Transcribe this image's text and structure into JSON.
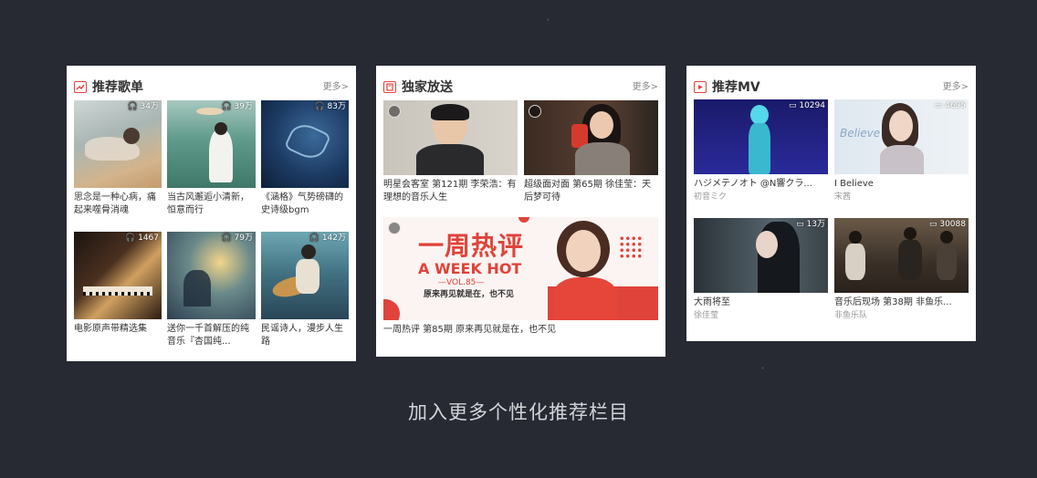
{
  "playlists": {
    "title": "推荐歌单",
    "more": "更多>",
    "items": [
      {
        "count": "34万",
        "caption": "思念是一种心病，痛起来噬骨消魂"
      },
      {
        "count": "39万",
        "caption": "当古风邂逅小清新，恒意而行"
      },
      {
        "count": "83万",
        "caption": "《涵格》气势磅礴的史诗级bgm"
      },
      {
        "count": "1467",
        "caption": "电影原声带精选集"
      },
      {
        "count": "79万",
        "caption": "送你一千首解压的纯音乐『杏国纯..."
      },
      {
        "count": "142万",
        "caption": "民谣诗人，漫步人生路"
      }
    ]
  },
  "exclusive": {
    "title": "独家放送",
    "more": "更多>",
    "items": [
      {
        "caption": "明星会客室 第121期 李荣浩：有理想的音乐人生"
      },
      {
        "caption": "超级面对面 第65期 徐佳莹：天后梦可待"
      }
    ],
    "banner": {
      "headline": "一周热评",
      "english": "A WEEK HOT",
      "vol": "—VOL.85—",
      "tagline": "原来再见就是在，也不见",
      "caption": "一周热评 第85期 原来再见就是在，也不见"
    }
  },
  "mv": {
    "title": "推荐MV",
    "more": "更多>",
    "items": [
      {
        "count": "10294",
        "caption": "ハジメテノオト @N響クラ...",
        "artist": "初音ミク"
      },
      {
        "count": "4695",
        "caption": "I Believe",
        "artist": "宋茜"
      },
      {
        "count": "13万",
        "caption": "大雨将至",
        "artist": "徐佳莹"
      },
      {
        "count": "30088",
        "caption": "音乐后现场 第38期 非鱼乐...",
        "artist": "非鱼乐队"
      }
    ]
  },
  "footer": "加入更多个性化推荐栏目",
  "colors": {
    "accent": "#e0433a",
    "background": "#272a33",
    "card": "#ffffff"
  }
}
